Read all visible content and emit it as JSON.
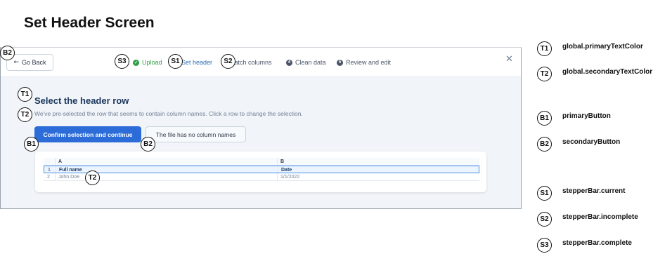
{
  "page_title": "Set Header Screen",
  "app": {
    "go_back_label": "Go Back",
    "go_back_icon": "arrow-left-icon",
    "close_icon": "close-icon",
    "stepper": {
      "upload": "Upload",
      "set_header": "Set header",
      "match_columns": "Match columns",
      "clean_data": "Clean data",
      "review_and_edit": "Review and edit"
    },
    "content_title": "Select the header row",
    "content_subtitle": "We've pre-selected the row that seems to contain column names. Click a row to change the selection.",
    "primary_button": "Confirm selection and continue",
    "secondary_button": "The file has no column names",
    "table": {
      "columns": [
        "A",
        "B"
      ],
      "rows": [
        {
          "num": "1",
          "a": "Full name",
          "b": "Date"
        },
        {
          "num": "2",
          "a": "John Doe",
          "b": "1/1/2022"
        }
      ]
    }
  },
  "markers": {
    "T1": "T1",
    "T2": "T2",
    "B1": "B1",
    "B2": "B2",
    "S1": "S1",
    "S2": "S2",
    "S3": "S3"
  },
  "legend": [
    {
      "code": "T1",
      "label": "global.primaryTextColor"
    },
    {
      "code": "T2",
      "label": "global.secondaryTextColor"
    },
    {
      "code": "B1",
      "label": "primaryButton"
    },
    {
      "code": "B2",
      "label": "secondaryButton"
    },
    {
      "code": "S1",
      "label": "stepperBar.current"
    },
    {
      "code": "S2",
      "label": "stepperBar.incomplete"
    },
    {
      "code": "S3",
      "label": "stepperBar.complete"
    }
  ],
  "colors": {
    "primary": "#2b6cd8",
    "complete": "#2f9e44",
    "current": "#2b6cb0"
  }
}
